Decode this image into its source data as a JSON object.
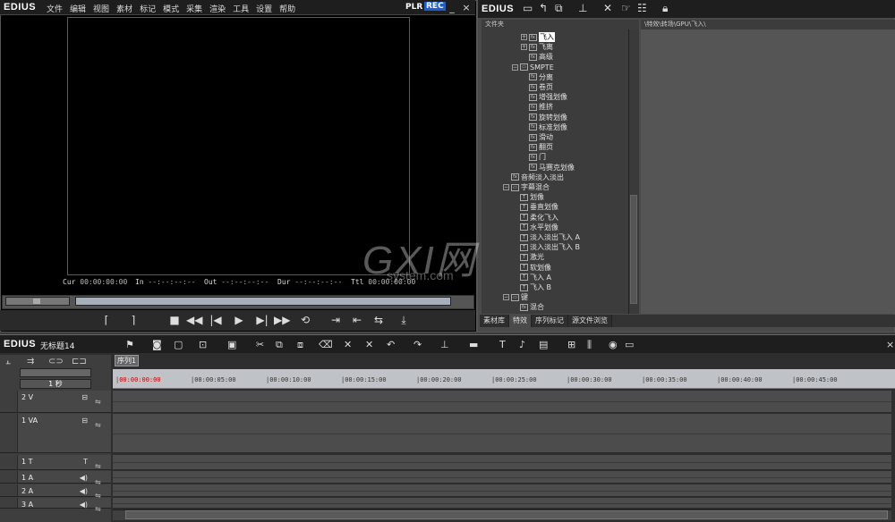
{
  "player": {
    "logo": "EDIUS",
    "menu": [
      "文件",
      "编辑",
      "视图",
      "素材",
      "标记",
      "模式",
      "采集",
      "渲染",
      "工具",
      "设置",
      "帮助"
    ],
    "plr": "PLR",
    "rec": "REC",
    "minimize": "_",
    "close": "×",
    "timecodes": [
      {
        "label": "Cur",
        "value": "00:00:00:00"
      },
      {
        "label": "In",
        "value": "--:--:--:--"
      },
      {
        "label": "Out",
        "value": "--:--:--:--"
      },
      {
        "label": "Dur",
        "value": "--:--:--:--"
      },
      {
        "label": "Ttl",
        "value": "00:00:00:00"
      }
    ],
    "transport_icons": [
      "set-in-icon",
      "set-out-icon",
      "stop-icon",
      "rewind-icon",
      "step-back-icon",
      "play-icon",
      "step-forward-icon",
      "fast-forward-icon",
      "loop-icon",
      "insert-icon",
      "overwrite-icon",
      "replace-icon",
      "export-icon"
    ]
  },
  "bin": {
    "logo": "EDIUS",
    "folder_header": "文件夹",
    "path": "\\特效\\转场\\GPU\\飞入\\",
    "tree": [
      {
        "label": "飞入",
        "indent": 4,
        "kind": "fx",
        "expander": "+",
        "selected": true
      },
      {
        "label": "飞离",
        "indent": 4,
        "kind": "fx",
        "expander": "+"
      },
      {
        "label": "高级",
        "indent": 4,
        "kind": "fx"
      },
      {
        "label": "SMPTE",
        "indent": 3,
        "kind": "folder",
        "expander": "−"
      },
      {
        "label": "分离",
        "indent": 4,
        "kind": "fx"
      },
      {
        "label": "卷页",
        "indent": 4,
        "kind": "fx"
      },
      {
        "label": "增强划像",
        "indent": 4,
        "kind": "fx"
      },
      {
        "label": "推挤",
        "indent": 4,
        "kind": "fx"
      },
      {
        "label": "旋转划像",
        "indent": 4,
        "kind": "fx"
      },
      {
        "label": "标准划像",
        "indent": 4,
        "kind": "fx"
      },
      {
        "label": "滑动",
        "indent": 4,
        "kind": "fx"
      },
      {
        "label": "翻页",
        "indent": 4,
        "kind": "fx"
      },
      {
        "label": "门",
        "indent": 4,
        "kind": "fx"
      },
      {
        "label": "马赛克划像",
        "indent": 4,
        "kind": "fx"
      },
      {
        "label": "音频淡入淡出",
        "indent": 2,
        "kind": "fx"
      },
      {
        "label": "字幕混合",
        "indent": 2,
        "kind": "folder",
        "expander": "−"
      },
      {
        "label": "划像",
        "indent": 3,
        "kind": "title"
      },
      {
        "label": "垂直划像",
        "indent": 3,
        "kind": "title"
      },
      {
        "label": "柔化飞入",
        "indent": 3,
        "kind": "title"
      },
      {
        "label": "水平划像",
        "indent": 3,
        "kind": "title"
      },
      {
        "label": "淡入淡出飞入 A",
        "indent": 3,
        "kind": "title"
      },
      {
        "label": "淡入淡出飞入 B",
        "indent": 3,
        "kind": "title"
      },
      {
        "label": "激光",
        "indent": 3,
        "kind": "title"
      },
      {
        "label": "软划像",
        "indent": 3,
        "kind": "title"
      },
      {
        "label": "飞入 A",
        "indent": 3,
        "kind": "title"
      },
      {
        "label": "飞入 B",
        "indent": 3,
        "kind": "title"
      },
      {
        "label": "键",
        "indent": 2,
        "kind": "folder",
        "expander": "−"
      },
      {
        "label": "混合",
        "indent": 3,
        "kind": "fx"
      }
    ],
    "tabs": [
      "素材库",
      "特效",
      "序列标记",
      "源文件浏览"
    ],
    "active_tab": 1
  },
  "timeline": {
    "logo": "EDIUS",
    "project_title": "无标题14",
    "sequence_tab": "序列1",
    "scale": "1 秒",
    "ruler_labels": [
      "00:00:00:00",
      "00:00:05:00",
      "00:00:10:00",
      "00:00:15:00",
      "00:00:20:00",
      "00:00:25:00",
      "00:00:30:00",
      "00:00:35:00",
      "00:00:40:00",
      "00:00:45:00"
    ],
    "tracks": [
      {
        "name": "2 V",
        "icon": "⊟"
      },
      {
        "name": "1 VA",
        "icon": "⊟"
      },
      {
        "name": "1 T",
        "icon": "T"
      },
      {
        "name": "1 A",
        "icon": "◀)"
      },
      {
        "name": "2 A",
        "icon": "◀)"
      },
      {
        "name": "3 A",
        "icon": "◀)"
      }
    ]
  },
  "watermark": {
    "main": "GXI网",
    "sub": "system.com"
  }
}
